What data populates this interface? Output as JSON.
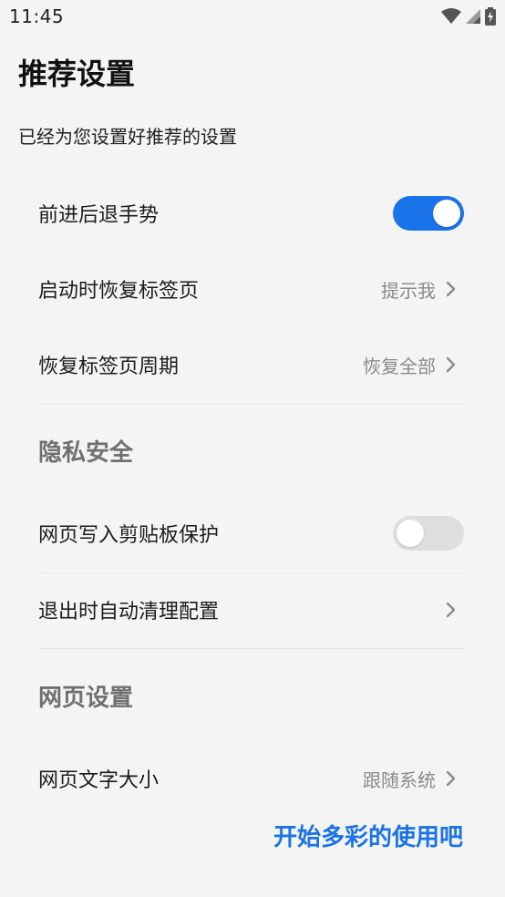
{
  "status_bar": {
    "time": "11:45",
    "icons": [
      "wifi-icon",
      "cellular-signal-icon",
      "battery-charging-icon"
    ]
  },
  "page": {
    "title": "推荐设置",
    "subtitle": "已经为您设置好推荐的设置"
  },
  "settings": {
    "gesture": {
      "label": "前进后退手势",
      "enabled": true
    },
    "restore_tabs": {
      "label": "启动时恢复标签页",
      "value": "提示我"
    },
    "restore_period": {
      "label": "恢复标签页周期",
      "value": "恢复全部"
    }
  },
  "privacy": {
    "header": "隐私安全",
    "clipboard": {
      "label": "网页写入剪贴板保护",
      "enabled": false
    },
    "auto_clean": {
      "label": "退出时自动清理配置"
    }
  },
  "web": {
    "header": "网页设置",
    "font_size": {
      "label": "网页文字大小",
      "value": "跟随系统"
    }
  },
  "footer": {
    "start_label": "开始多彩的使用吧"
  },
  "colors": {
    "accent": "#1a73e8",
    "background": "#f4f4f4",
    "toggle_off": "#dedede",
    "secondary_text": "#8a8a8a"
  }
}
